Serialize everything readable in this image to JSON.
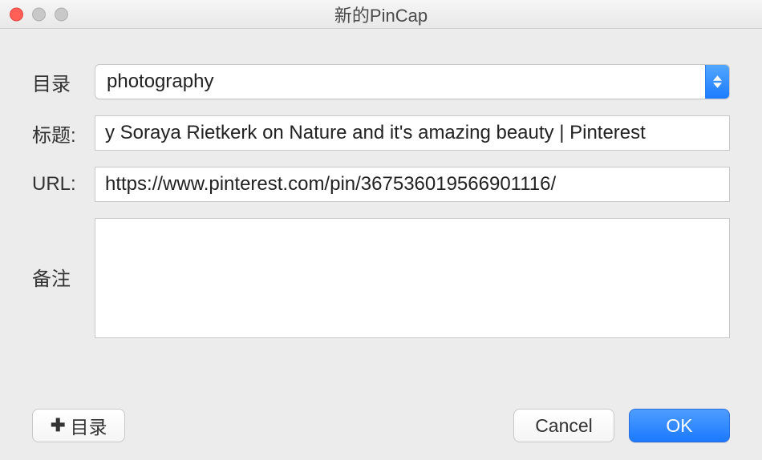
{
  "window": {
    "title": "新的PinCap"
  },
  "labels": {
    "directory": "目录",
    "title": "标题:",
    "url": "URL:",
    "notes": "备注"
  },
  "fields": {
    "directory": {
      "selected": "photography"
    },
    "title": {
      "value": "y Soraya Rietkerk on Nature and it's amazing beauty | Pinterest"
    },
    "url": {
      "value": "https://www.pinterest.com/pin/367536019566901116/"
    },
    "notes": {
      "value": ""
    }
  },
  "buttons": {
    "add_directory": "目录",
    "cancel": "Cancel",
    "ok": "OK"
  },
  "icons": {
    "plus": "✚"
  }
}
